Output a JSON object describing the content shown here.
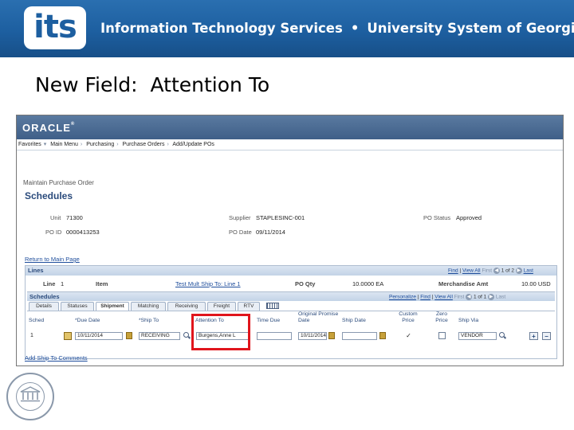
{
  "banner": {
    "logo": "its",
    "text_left": "Information Technology Services",
    "bullet": "•",
    "text_right": "University System of Georgia"
  },
  "slide_title": "New Field:  Attention To",
  "app": {
    "brand": "ORACLE",
    "nav": [
      "Favorites",
      "Main Menu",
      "Purchasing",
      "Purchase Orders",
      "Add/Update POs"
    ],
    "page_subtitle": "Maintain Purchase Order",
    "page_heading": "Schedules",
    "unit_label": "Unit",
    "unit_value": "71300",
    "supplier_label": "Supplier",
    "supplier_value": "STAPLESINC-001",
    "po_status_label": "PO Status",
    "po_status_value": "Approved",
    "po_id_label": "PO ID",
    "po_id_value": "0000413253",
    "po_date_label": "PO Date",
    "po_date_value": "09/11/2014",
    "return_link": "Return to Main Page",
    "lines": {
      "title": "Lines",
      "find": "Find",
      "view_all": "View All",
      "first": "First",
      "counter": "1 of 2",
      "last": "Last",
      "line_label": "Line",
      "line_value": "1",
      "item_label": "Item",
      "multi_ship_link": "Test Mult Ship To: Line 1",
      "po_qty_label": "PO Qty",
      "po_qty_value": "10.0000 EA",
      "merch_label": "Merchandise Amt",
      "merch_value": "10.00 USD"
    },
    "schedules": {
      "title": "Schedules",
      "personalize": "Personalize",
      "find": "Find",
      "view_all": "View All",
      "first": "First",
      "counter": "1 of 1",
      "last": "Last",
      "tabs": [
        "Details",
        "Statuses",
        "Shipment",
        "Matching",
        "Receiving",
        "Freight",
        "RTV"
      ],
      "columns": {
        "sched": "Sched",
        "due_date": "*Due Date",
        "ship_to": "*Ship To",
        "attention_to": "Attention To",
        "time_due": "Time Due",
        "orig_promise": "Original Promise Date",
        "ship_date": "Ship Date",
        "custom_price": "Custom Price",
        "zero_price": "Zero Price",
        "ship_via": "Ship Via"
      },
      "row": {
        "sched": "1",
        "due_date": "10/11/2014",
        "ship_to": "RECEIVING",
        "attention_to": "Burgens,Anne L",
        "time_due": "",
        "orig_promise": "10/11/2014",
        "ship_date": "",
        "custom_price": "✓",
        "zero_price": "",
        "ship_via": "VENDOR",
        "add": "+",
        "remove": "−"
      }
    },
    "add_comments_link": "Add Ship To Comments"
  }
}
